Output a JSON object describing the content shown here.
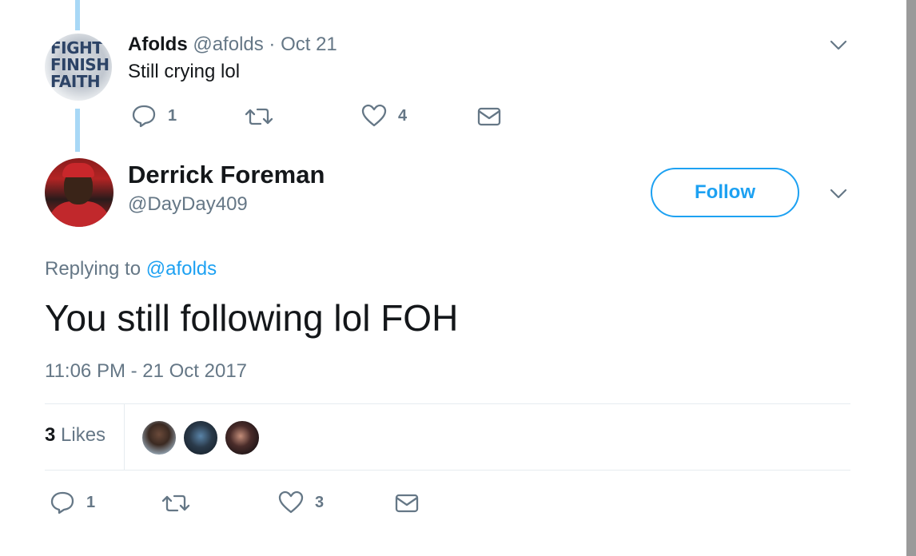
{
  "parent_tweet": {
    "avatar_text": "FIGHT\nFINISH\nFAITH",
    "name": "Afolds",
    "handle": "@afolds",
    "separator": " · ",
    "date": "Oct 21",
    "text": "Still crying lol",
    "actions": {
      "reply_count": "1",
      "retweet_count": "",
      "like_count": "4"
    },
    "icons": [
      "reply-icon",
      "retweet-icon",
      "like-icon",
      "message-icon",
      "chevron-down-icon"
    ]
  },
  "main_tweet": {
    "name": "Derrick Foreman",
    "handle": "@DayDay409",
    "follow_label": "Follow",
    "replying_prefix": "Replying to ",
    "replying_handle": "@afolds",
    "text": "You still following lol FOH",
    "timestamp": "11:06 PM - 21 Oct 2017",
    "likes_count": "3",
    "likes_label": " Likes",
    "actions": {
      "reply_count": "1",
      "retweet_count": "",
      "like_count": "3"
    },
    "icons": [
      "reply-icon",
      "retweet-icon",
      "like-icon",
      "message-icon",
      "chevron-down-icon"
    ]
  },
  "colors": {
    "accent": "#1da1f2",
    "muted_text": "#657786",
    "primary_text": "#14171a",
    "thread_line": "#a8d8f6",
    "divider": "#e6ecf0"
  }
}
